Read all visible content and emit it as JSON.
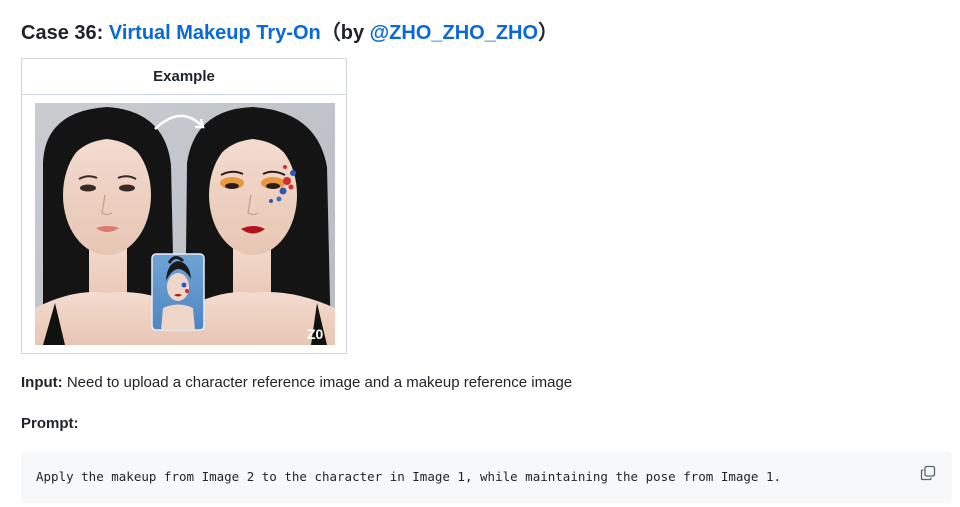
{
  "heading": {
    "prefix": "Case 36: ",
    "title_link": "Virtual Makeup Try-On",
    "by_open": "（by ",
    "author_link": "@ZHO_ZHO_ZHO",
    "by_close": "）"
  },
  "example": {
    "header": "Example",
    "image_watermark": "Z0"
  },
  "input": {
    "label": "Input:",
    "text": " Need to upload a character reference image and a makeup reference image"
  },
  "prompt": {
    "label": "Prompt:",
    "code": "Apply the makeup from Image 2 to the character in Image 1, while maintaining the pose from Image 1."
  },
  "icons": {
    "copy": "copy-icon"
  },
  "colors": {
    "link": "#0969da",
    "code_bg": "#f6f8fa",
    "border": "#d0d7de"
  }
}
